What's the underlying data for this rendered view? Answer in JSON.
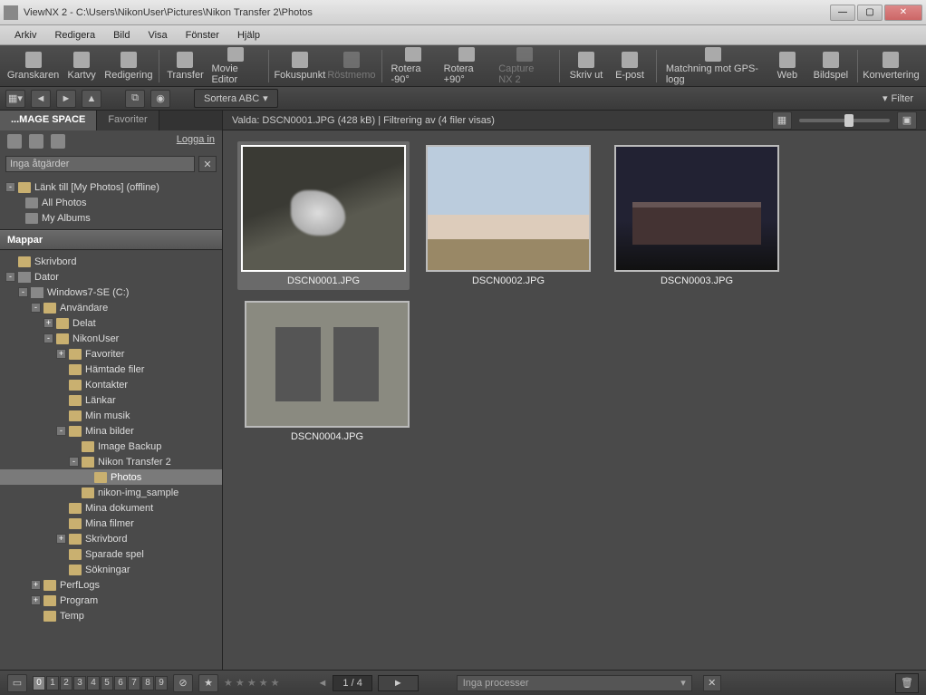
{
  "window": {
    "title": "ViewNX 2 - C:\\Users\\NikonUser\\Pictures\\Nikon Transfer 2\\Photos"
  },
  "menu": [
    "Arkiv",
    "Redigera",
    "Bild",
    "Visa",
    "Fönster",
    "Hjälp"
  ],
  "toolbar": [
    {
      "label": "Granskaren",
      "enabled": true
    },
    {
      "label": "Kartvy",
      "enabled": true
    },
    {
      "label": "Redigering",
      "enabled": true
    },
    {
      "label": "Transfer",
      "enabled": true
    },
    {
      "label": "Movie Editor",
      "enabled": true
    },
    {
      "label": "Fokuspunkt",
      "enabled": true
    },
    {
      "label": "Röstmemo",
      "enabled": false
    },
    {
      "label": "Rotera -90°",
      "enabled": true
    },
    {
      "label": "Rotera +90°",
      "enabled": true
    },
    {
      "label": "Capture NX 2",
      "enabled": false
    },
    {
      "label": "Skriv ut",
      "enabled": true
    },
    {
      "label": "E-post",
      "enabled": true
    },
    {
      "label": "Matchning mot GPS-logg",
      "enabled": true
    },
    {
      "label": "Web",
      "enabled": true
    },
    {
      "label": "Bildspel",
      "enabled": true
    },
    {
      "label": "Konvertering",
      "enabled": true
    }
  ],
  "secbar": {
    "sort_label": "Sortera ABC",
    "filter_label": "Filter"
  },
  "left": {
    "tabs": [
      "...MAGE SPACE",
      "Favoriter"
    ],
    "login": "Logga in",
    "actions_value": "Inga åtgärder",
    "link_header": "Länk till [My Photos] (offline)",
    "link_items": [
      "All Photos",
      "My Albums"
    ],
    "folders_title": "Mappar",
    "tree": [
      {
        "d": 0,
        "exp": "",
        "icon": "desktop",
        "label": "Skrivbord"
      },
      {
        "d": 0,
        "exp": "-",
        "icon": "drive",
        "label": "Dator"
      },
      {
        "d": 1,
        "exp": "-",
        "icon": "drive",
        "label": "Windows7-SE (C:)"
      },
      {
        "d": 2,
        "exp": "-",
        "icon": "folder",
        "label": "Användare"
      },
      {
        "d": 3,
        "exp": "+",
        "icon": "folder",
        "label": "Delat"
      },
      {
        "d": 3,
        "exp": "-",
        "icon": "folder",
        "label": "NikonUser"
      },
      {
        "d": 4,
        "exp": "+",
        "icon": "folder",
        "label": "Favoriter"
      },
      {
        "d": 4,
        "exp": "",
        "icon": "folder",
        "label": "Hämtade filer"
      },
      {
        "d": 4,
        "exp": "",
        "icon": "folder",
        "label": "Kontakter"
      },
      {
        "d": 4,
        "exp": "",
        "icon": "folder",
        "label": "Länkar"
      },
      {
        "d": 4,
        "exp": "",
        "icon": "folder",
        "label": "Min musik"
      },
      {
        "d": 4,
        "exp": "-",
        "icon": "folder",
        "label": "Mina bilder"
      },
      {
        "d": 5,
        "exp": "",
        "icon": "folder",
        "label": "Image Backup"
      },
      {
        "d": 5,
        "exp": "-",
        "icon": "folder",
        "label": "Nikon Transfer 2"
      },
      {
        "d": 6,
        "exp": "",
        "icon": "folder",
        "label": "Photos",
        "sel": true
      },
      {
        "d": 5,
        "exp": "",
        "icon": "folder",
        "label": "nikon-img_sample"
      },
      {
        "d": 4,
        "exp": "",
        "icon": "folder",
        "label": "Mina dokument"
      },
      {
        "d": 4,
        "exp": "",
        "icon": "folder",
        "label": "Mina filmer"
      },
      {
        "d": 4,
        "exp": "+",
        "icon": "folder",
        "label": "Skrivbord"
      },
      {
        "d": 4,
        "exp": "",
        "icon": "folder",
        "label": "Sparade spel"
      },
      {
        "d": 4,
        "exp": "",
        "icon": "folder",
        "label": "Sökningar"
      },
      {
        "d": 2,
        "exp": "+",
        "icon": "folder",
        "label": "PerfLogs"
      },
      {
        "d": 2,
        "exp": "+",
        "icon": "folder",
        "label": "Program"
      },
      {
        "d": 2,
        "exp": "",
        "icon": "folder",
        "label": "Temp"
      }
    ]
  },
  "content": {
    "infobar": "Valda: DSCN0001.JPG (428 kB) | Filtrering av  (4 filer visas)",
    "thumbs": [
      {
        "caption": "DSCN0001.JPG",
        "sel": true,
        "img": "img1"
      },
      {
        "caption": "DSCN0002.JPG",
        "sel": false,
        "img": "img2"
      },
      {
        "caption": "DSCN0003.JPG",
        "sel": false,
        "img": "img3"
      },
      {
        "caption": "DSCN0004.JPG",
        "sel": false,
        "img": "img4"
      }
    ]
  },
  "status": {
    "digits": [
      "0",
      "1",
      "2",
      "3",
      "4",
      "5",
      "6",
      "7",
      "8",
      "9"
    ],
    "active_digit": 0,
    "page": "1 / 4",
    "process_text": "Inga processer"
  }
}
